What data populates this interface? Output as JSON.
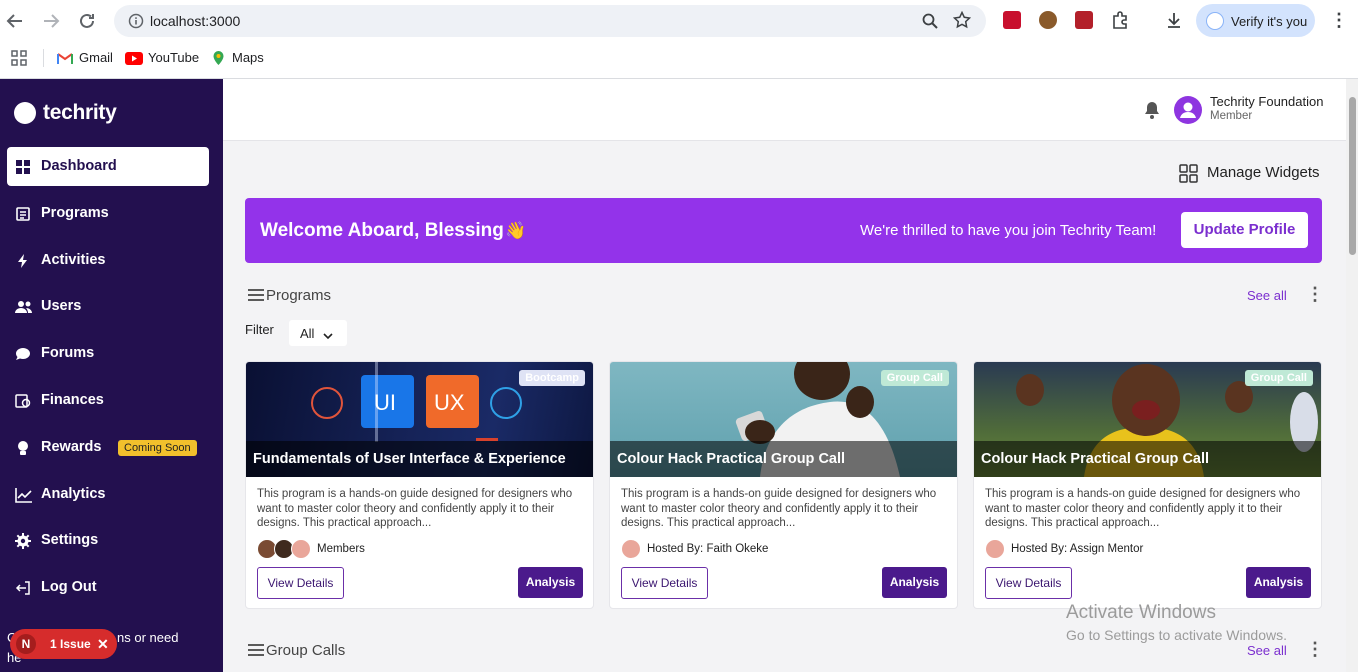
{
  "browser": {
    "url": "localhost:3000",
    "verify_label": "Verify it's you",
    "bookmarks": [
      "Gmail",
      "YouTube",
      "Maps"
    ]
  },
  "sidebar": {
    "brand": "techrity",
    "items": [
      {
        "label": "Dashboard",
        "icon": "grid-icon"
      },
      {
        "label": "Programs",
        "icon": "book-icon"
      },
      {
        "label": "Activities",
        "icon": "bolt-icon"
      },
      {
        "label": "Users",
        "icon": "users-icon"
      },
      {
        "label": "Forums",
        "icon": "chat-icon"
      },
      {
        "label": "Finances",
        "icon": "finance-icon"
      },
      {
        "label": "Rewards",
        "icon": "trophy-icon"
      },
      {
        "label": "Analytics",
        "icon": "chart-icon"
      },
      {
        "label": "Settings",
        "icon": "gear-icon"
      },
      {
        "label": "Log Out",
        "icon": "logout-icon"
      }
    ],
    "coming_soon": "Coming Soon",
    "footer_partial_1": "C",
    "footer_partial_2": "ns or need",
    "footer_partial_3": "he"
  },
  "header": {
    "org_name": "Techrity Foundation",
    "role": "Member"
  },
  "manage_widgets": "Manage Widgets",
  "welcome": {
    "title": "Welcome Aboard, Blessing",
    "emoji": "👋",
    "message": "We're thrilled to have you join Techrity Team!",
    "button": "Update Profile"
  },
  "programs": {
    "section_title": "Programs",
    "see_all": "See all",
    "filter_label": "Filter",
    "filter_value": "All",
    "cards": [
      {
        "badge": "Bootcamp",
        "title": "Fundamentals of User Interface & Experience",
        "desc": "This program is a hands-on guide designed for designers who want to master color theory and confidently apply it to their designs. This practical approach...",
        "host": "Members",
        "view": "View Details",
        "analysis": "Analysis"
      },
      {
        "badge": "Group Call",
        "title": "Colour Hack Practical Group Call",
        "desc": "This program is a hands-on guide designed for designers who want to master color theory and confidently apply it to their designs. This practical approach...",
        "host": "Hosted By: Faith Okeke",
        "view": "View Details",
        "analysis": "Analysis"
      },
      {
        "badge": "Group Call",
        "title": "Colour Hack Practical Group Call",
        "desc": "This program is a hands-on guide designed for designers who want to master color theory and confidently apply it to their designs. This practical approach...",
        "host": "Hosted By: Assign Mentor",
        "view": "View Details",
        "analysis": "Analysis"
      }
    ],
    "card1_art": {
      "ui": "UI",
      "ux": "UX"
    }
  },
  "group_calls": {
    "section_title": "Group Calls",
    "see_all": "See all"
  },
  "issue": {
    "letter": "N",
    "label": "1 Issue"
  },
  "windows": {
    "line1": "Activate Windows",
    "line2": "Go to Settings to activate Windows."
  },
  "colors": {
    "sidebar": "#23104f",
    "accent": "#9333ea",
    "analysis_btn": "#4b1a8c"
  }
}
